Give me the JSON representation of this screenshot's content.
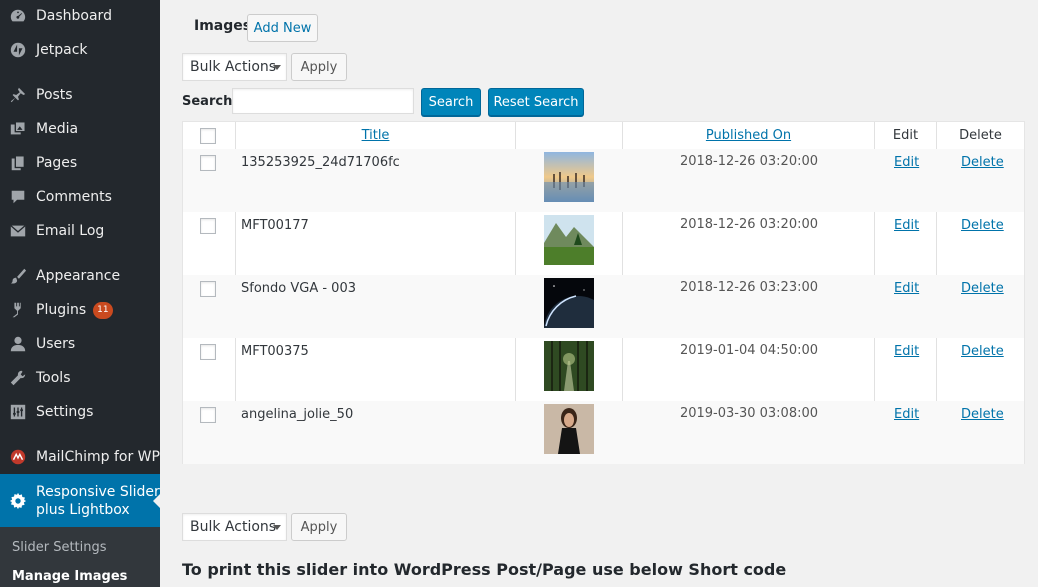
{
  "sidebar": {
    "items": [
      {
        "label": "Dashboard",
        "icon": "dashboard-icon"
      },
      {
        "label": "Jetpack",
        "icon": "jetpack-icon"
      },
      {
        "label": "Posts",
        "icon": "pin-icon"
      },
      {
        "label": "Media",
        "icon": "media-icon"
      },
      {
        "label": "Pages",
        "icon": "pages-icon"
      },
      {
        "label": "Comments",
        "icon": "comment-icon"
      },
      {
        "label": "Email Log",
        "icon": "email-icon"
      },
      {
        "label": "Appearance",
        "icon": "brush-icon"
      },
      {
        "label": "Plugins",
        "icon": "plugin-icon",
        "badge": "11"
      },
      {
        "label": "Users",
        "icon": "user-icon"
      },
      {
        "label": "Tools",
        "icon": "wrench-icon"
      },
      {
        "label": "Settings",
        "icon": "settings-icon"
      },
      {
        "label": "MailChimp for WP",
        "icon": "mailchimp-icon"
      }
    ],
    "active": {
      "label_line1": "Responsive Slider",
      "label_line2": "plus Lightbox",
      "icon": "gear-icon"
    },
    "submenu": [
      {
        "label": "Slider Settings"
      },
      {
        "label": "Manage Images"
      }
    ]
  },
  "header": {
    "title": "Images",
    "add_new": "Add New"
  },
  "bulk": {
    "selected": "Bulk Actions",
    "apply": "Apply"
  },
  "search": {
    "label": "Search :",
    "value": "",
    "search_button": "Search",
    "reset_button": "Reset Search"
  },
  "table": {
    "columns": {
      "title": "Title",
      "published": "Published On",
      "edit": "Edit",
      "delete": "Delete"
    },
    "rows": [
      {
        "title": "135253925_24d71706fc",
        "date": "2018-12-26 03:20:00",
        "edit": "Edit",
        "delete": "Delete",
        "thumb": "sunset-lake"
      },
      {
        "title": "MFT00177",
        "date": "2018-12-26 03:20:00",
        "edit": "Edit",
        "delete": "Delete",
        "thumb": "mountain-meadow"
      },
      {
        "title": "Sfondo VGA - 003",
        "date": "2018-12-26 03:23:00",
        "edit": "Edit",
        "delete": "Delete",
        "thumb": "planet-space"
      },
      {
        "title": "MFT00375",
        "date": "2019-01-04 04:50:00",
        "edit": "Edit",
        "delete": "Delete",
        "thumb": "forest-path"
      },
      {
        "title": "angelina_jolie_50",
        "date": "2019-03-30 03:08:00",
        "edit": "Edit",
        "delete": "Delete",
        "thumb": "portrait"
      }
    ]
  },
  "footer": {
    "shortcode_text": "To print this slider into WordPress Post/Page use below Short code"
  },
  "colors": {
    "sidebar_bg": "#23282d",
    "active_blue": "#0073aa",
    "button_blue": "#0085ba",
    "badge": "#ca4a1f"
  }
}
